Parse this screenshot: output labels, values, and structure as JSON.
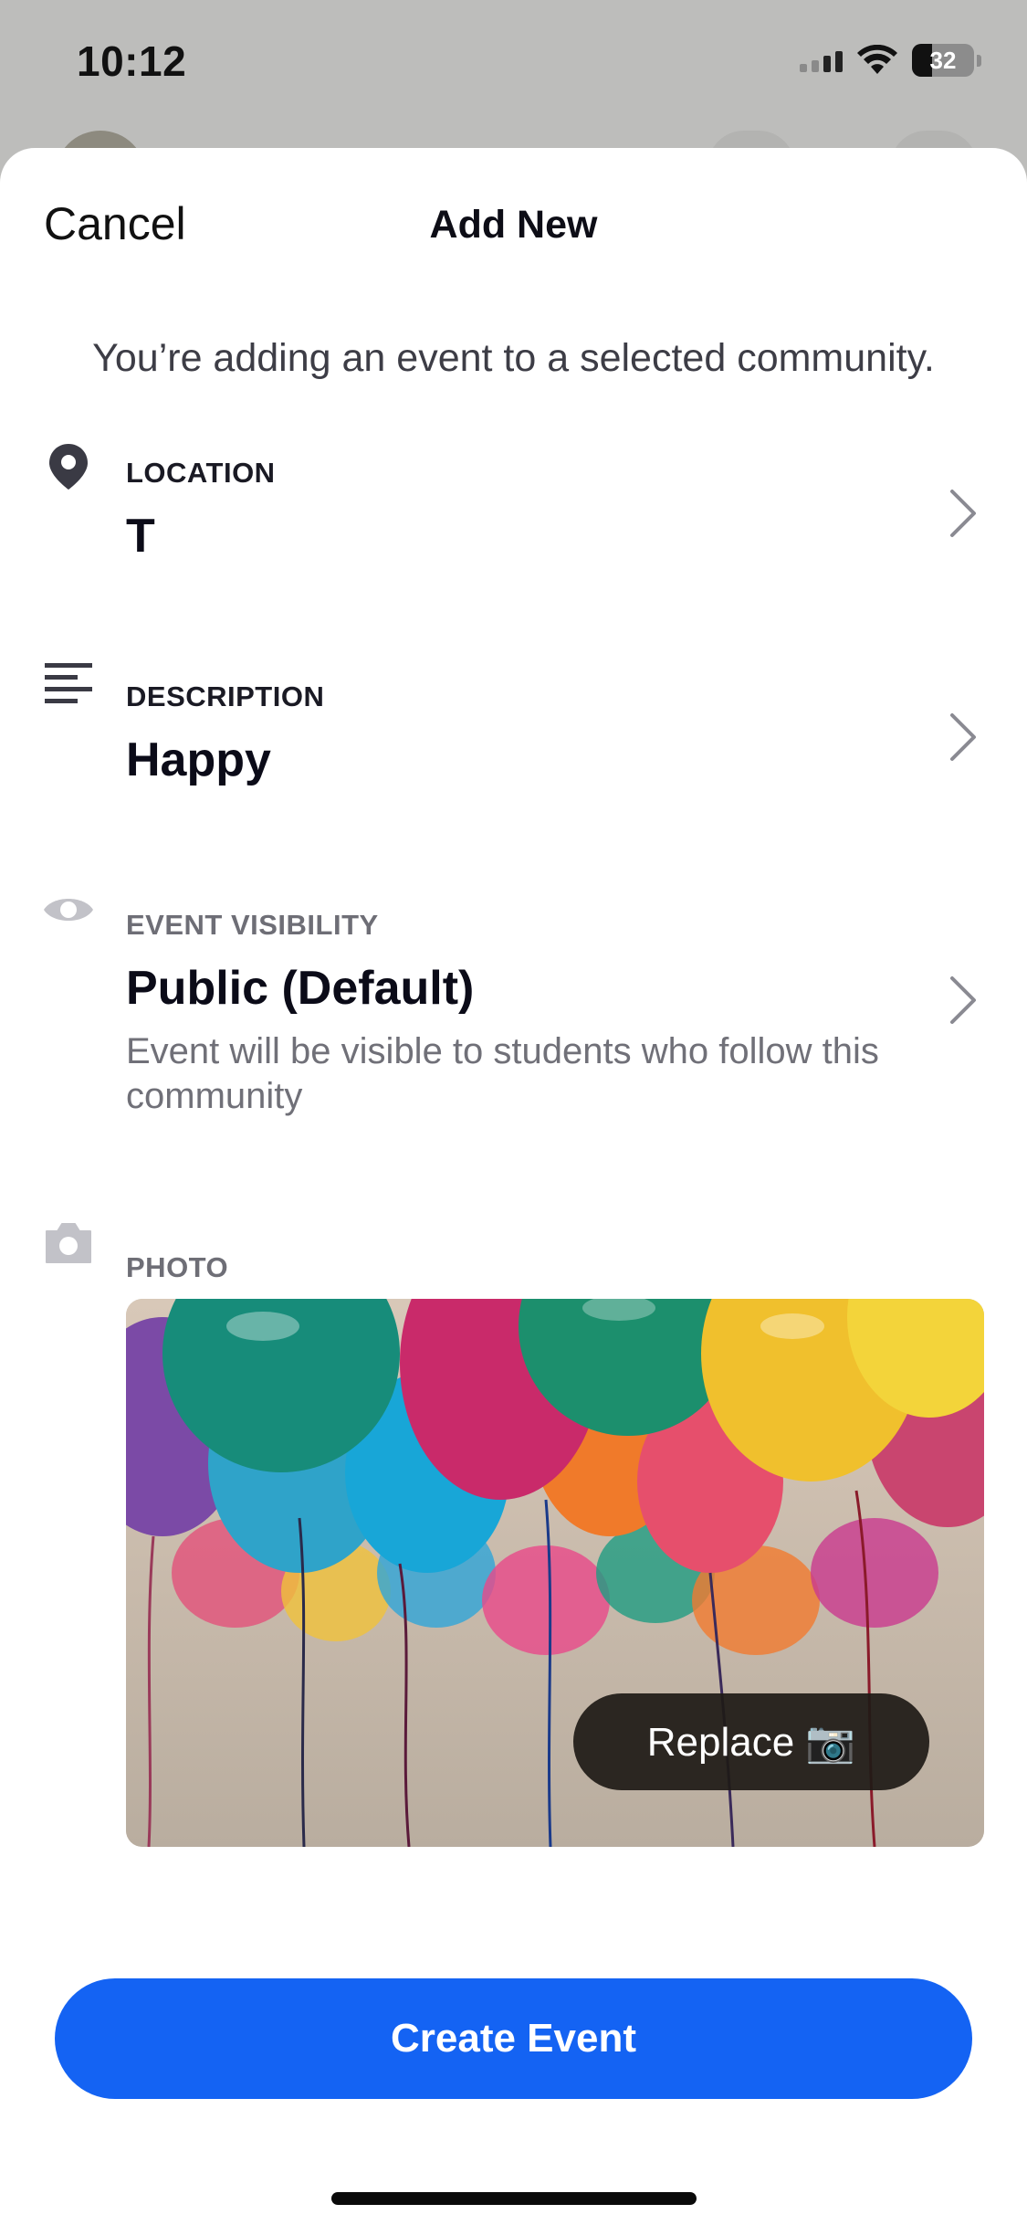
{
  "status_bar": {
    "time": "10:12",
    "battery": "32"
  },
  "sheet": {
    "cancel_label": "Cancel",
    "title": "Add New",
    "intro": "You’re adding an event to a selected community."
  },
  "location": {
    "label": "LOCATION",
    "value": "T",
    "icon": "location-pin-icon"
  },
  "description": {
    "label": "DESCRIPTION",
    "value": "Happy",
    "icon": "text-lines-icon"
  },
  "visibility": {
    "label": "EVENT VISIBILITY",
    "value": "Public (Default)",
    "sub": "Event will be visible to students who follow this community",
    "icon": "eye-icon"
  },
  "photo": {
    "label": "PHOTO",
    "replace_label": "Replace 📷",
    "icon": "camera-icon"
  },
  "colors": {
    "primary": "#1463f3",
    "label_dark": "#1a1a24",
    "label_gray": "#6e6e76"
  },
  "create_button_label": "Create Event"
}
